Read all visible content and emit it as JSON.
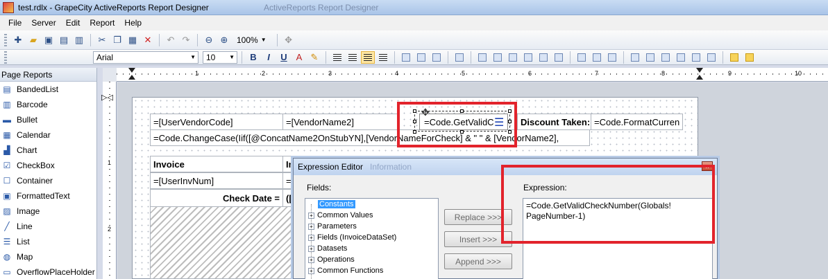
{
  "window": {
    "title": "test.rdlx - GrapeCity ActiveReports Report Designer",
    "ghost_title": "ActiveReports Report Designer"
  },
  "menu": [
    "File",
    "Server",
    "Edit",
    "Report",
    "Help"
  ],
  "toolbar": {
    "zoom": "100%",
    "font_name": "Arial",
    "font_size": "10",
    "bold": "B",
    "italic": "I",
    "underline": "U"
  },
  "toolbox": {
    "header": "Page Reports",
    "items": [
      "BandedList",
      "Barcode",
      "Bullet",
      "Calendar",
      "Chart",
      "CheckBox",
      "Container",
      "FormattedText",
      "Image",
      "Line",
      "List",
      "Map",
      "OverflowPlaceHolder"
    ],
    "icons": [
      "banded-list-icon",
      "barcode-icon",
      "bullet-icon",
      "calendar-icon",
      "chart-icon",
      "checkbox-icon",
      "container-icon",
      "formatted-text-icon",
      "image-icon",
      "line-icon",
      "list-icon",
      "map-icon",
      "overflow-placeholder-icon"
    ]
  },
  "ruler": {
    "numbers": [
      "1",
      "2",
      "3",
      "4",
      "5",
      "6",
      "7",
      "8",
      "9",
      "10"
    ],
    "vnumbers": [
      "1",
      "2"
    ]
  },
  "report": {
    "user_vendor_code": "=[UserVendorCode]",
    "vendor_name2": "=[VendorName2]",
    "get_valid_check": "=Code.GetValidC",
    "discount_taken": "Discount Taken:",
    "format_currency": "=Code.FormatCurren",
    "change_case": "=Code.ChangeCase(Iif([@ConcatName2OnStubYN],[VendorNameForCheck] & \" \" & [VendorName2],",
    "invoice": "Invoice",
    "invoice_partial": "In",
    "user_inv_num": "=[UserInvNum]",
    "user_inv_partial": "=F",
    "check_date": "Check Date =",
    "check_date_partial": "([@"
  },
  "dialog": {
    "title": "Expression Editor",
    "ghost": "Information",
    "close": "x",
    "fields_label": "Fields:",
    "expression_label": "Expression:",
    "tree": [
      "Constants",
      "Common Values",
      "Parameters",
      "Fields (InvoiceDataSet)",
      "Datasets",
      "Operations",
      "Common Functions"
    ],
    "buttons": [
      "Replace >>>",
      "Insert >>>",
      "Append >>>"
    ],
    "expression": "=Code.GetValidCheckNumber(Globals!\nPageNumber-1)"
  },
  "colors": {
    "highlight": "#e2232c",
    "selection": "#3399ff"
  }
}
